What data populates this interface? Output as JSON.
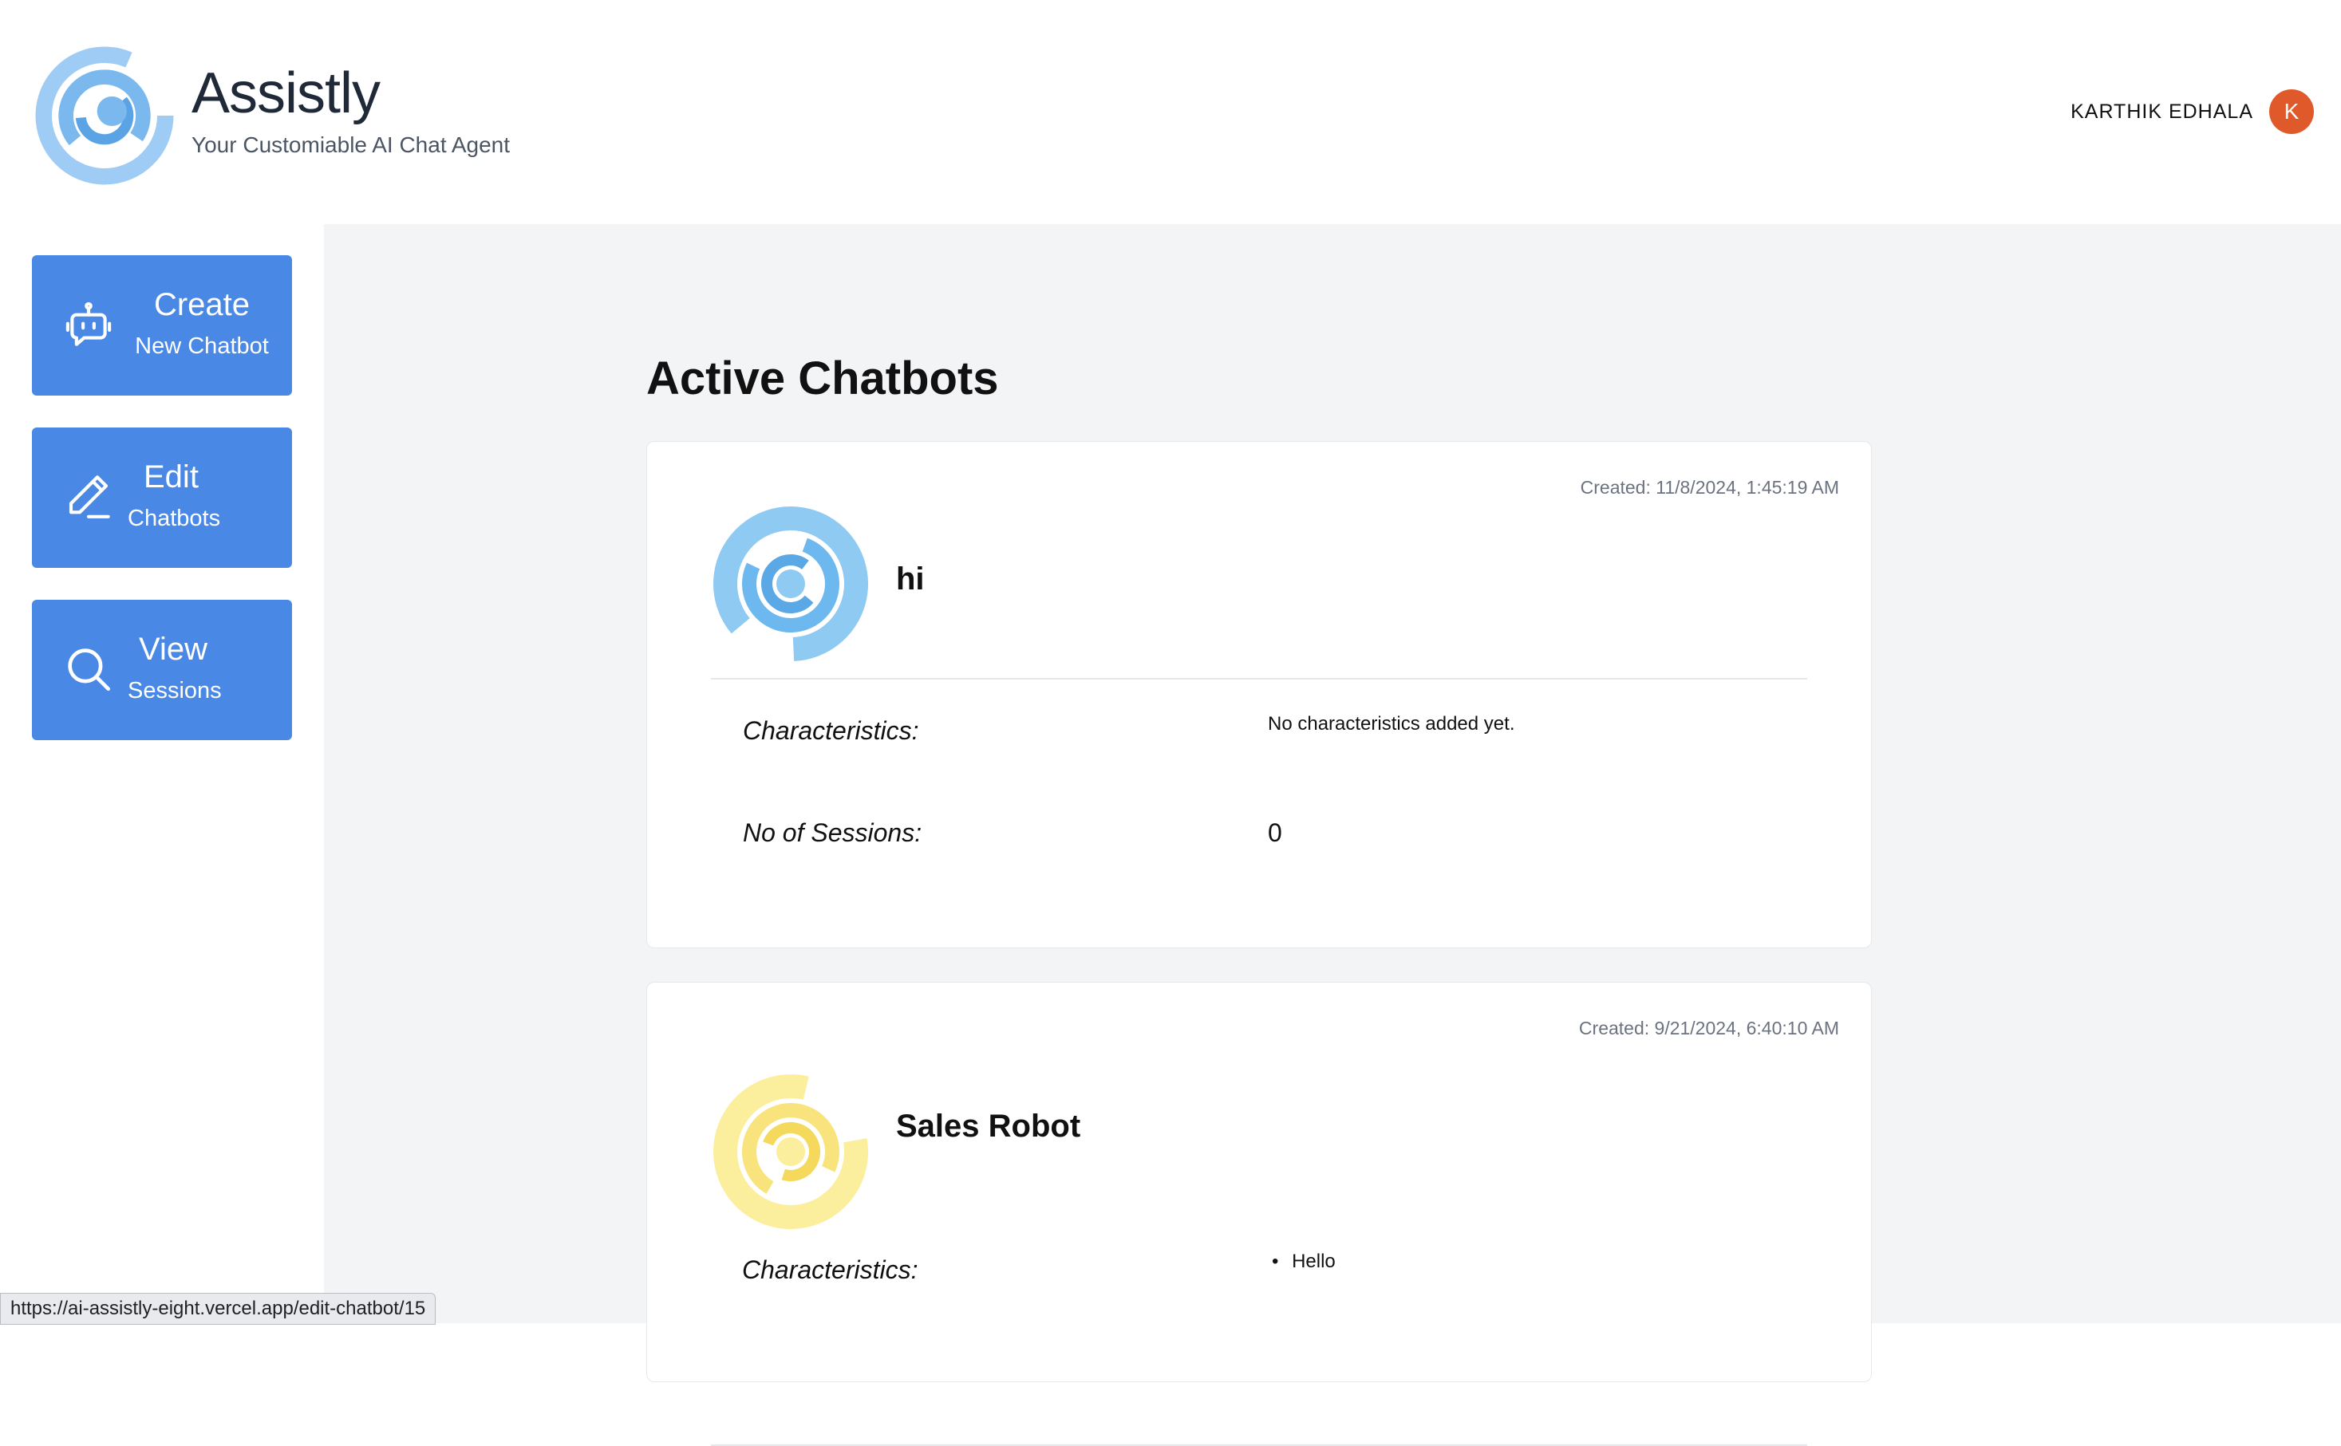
{
  "app": {
    "title": "Assistly",
    "subtitle": "Your Customiable AI Chat Agent"
  },
  "user": {
    "name": "KARTHIK EDHALA",
    "initial": "K"
  },
  "sidebar": {
    "items": [
      {
        "title": "Create",
        "subtitle": "New Chatbot",
        "icon": "robot-icon"
      },
      {
        "title": "Edit",
        "subtitle": "Chatbots",
        "icon": "pencil-icon"
      },
      {
        "title": "View",
        "subtitle": "Sessions",
        "icon": "search-icon"
      }
    ]
  },
  "main": {
    "heading": "Active Chatbots",
    "chatbots": [
      {
        "name": "hi",
        "created": "Created: 11/8/2024, 1:45:19 AM",
        "characteristics_label": "Characteristics:",
        "characteristics_value": "No characteristics added yet.",
        "sessions_label": "No of Sessions:",
        "sessions_value": "0",
        "avatar_color": "#7cc0f2"
      },
      {
        "name": "Sales Robot",
        "created": "Created: 9/21/2024, 6:40:10 AM",
        "characteristics_label": "Characteristics:",
        "characteristics_items": [
          "Hello"
        ],
        "avatar_color": "#f7e27a"
      }
    ]
  },
  "status_bar": {
    "url": "https://ai-assistly-eight.vercel.app/edit-chatbot/15"
  },
  "colors": {
    "accent": "#4a88e5",
    "avatar_bg": "#e0592a",
    "main_bg": "#f3f4f6"
  }
}
